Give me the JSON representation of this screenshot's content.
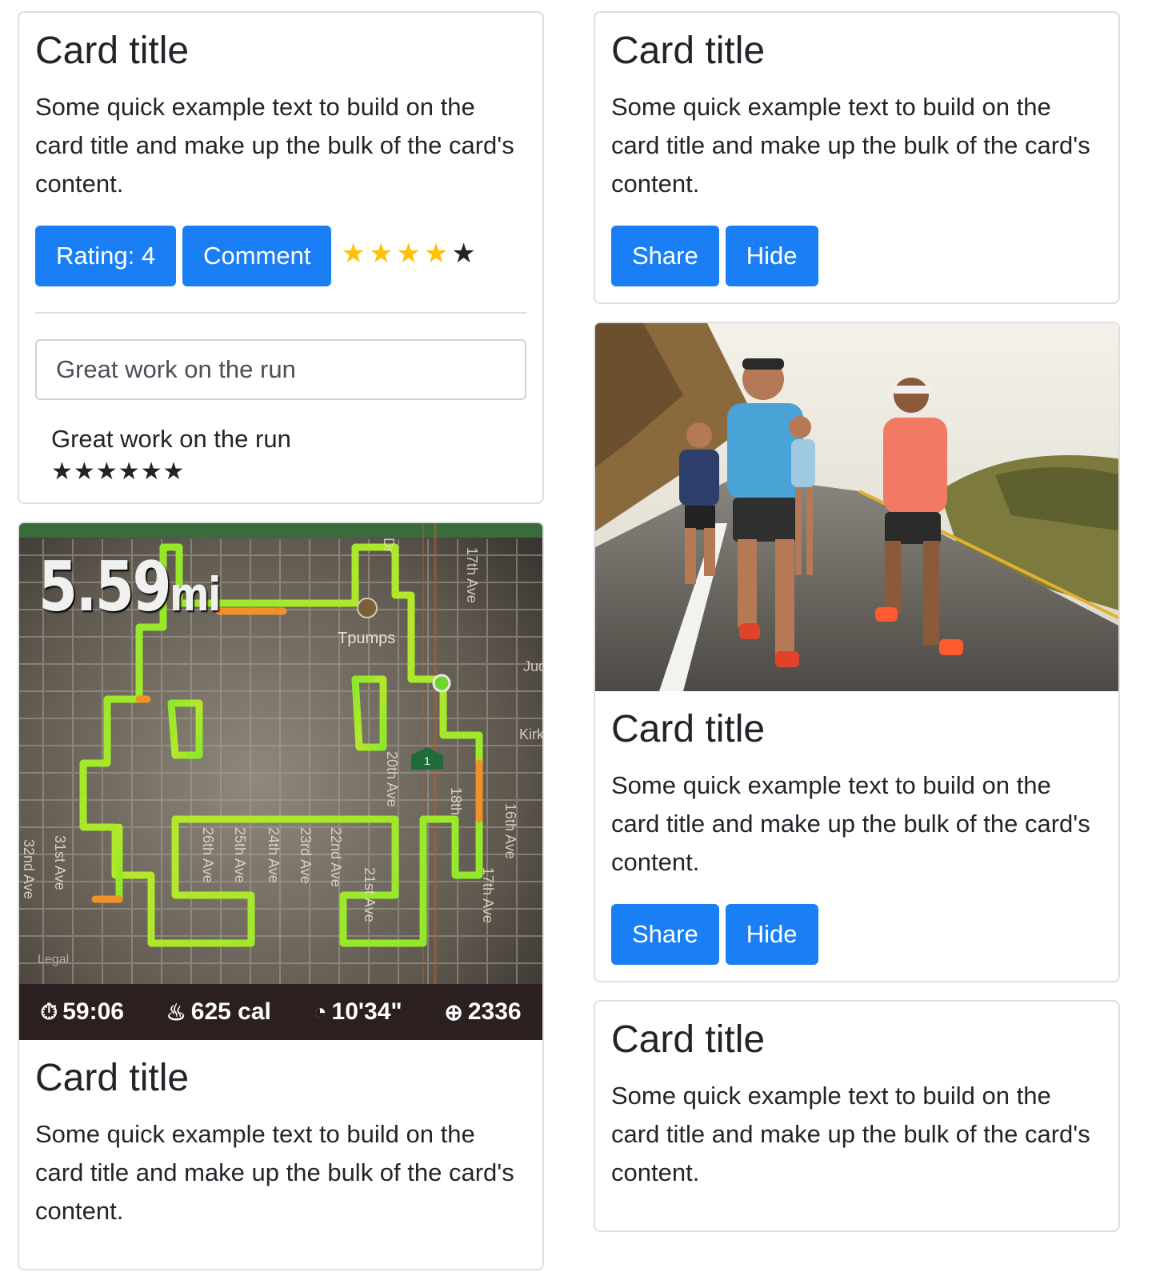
{
  "cards": {
    "rating_card": {
      "title": "Card title",
      "text": "Some quick example text to build on the card title and make up the bulk of the card's content.",
      "rating_button": "Rating: 4",
      "comment_button": "Comment",
      "rating": {
        "value": 4,
        "max": 5
      },
      "comment_input": {
        "value": "Great work on the run",
        "placeholder": ""
      },
      "comment": {
        "text": "Great work on the run",
        "stars": 6
      }
    },
    "map_card": {
      "distance": "5.59",
      "distance_unit": "mi",
      "poi_label": "Tpumps",
      "legal": "Legal",
      "street_labels": [
        "17th Ave",
        "Jud",
        "Kirk",
        "20th Ave",
        "18th",
        "16th Ave",
        "32nd Ave",
        "31st Ave",
        "26th Ave",
        "25th Ave",
        "24th Ave",
        "23rd Ave",
        "22nd Ave",
        "21st Ave",
        "17th Ave",
        "Dr"
      ],
      "marker_label": "1",
      "stats": {
        "time": "59:06",
        "calories": "625 cal",
        "pace": "10'34\"",
        "fuel": "2336"
      },
      "title": "Card title",
      "text": "Some quick example text to build on the card title and make up the bulk of the card's content."
    },
    "share_card_1": {
      "title": "Card title",
      "text": "Some quick example text to build on the card title and make up the bulk of the card's content.",
      "share_button": "Share",
      "hide_button": "Hide"
    },
    "photo_card": {
      "title": "Card title",
      "text": "Some quick example text to build on the card title and make up the bulk of the card's content.",
      "share_button": "Share",
      "hide_button": "Hide"
    },
    "text_card": {
      "title": "Card title",
      "text": "Some quick example text to build on the card title and make up the bulk of the card's content."
    }
  },
  "colors": {
    "primary": "#1a7ff5",
    "star_filled": "#ffc107",
    "star_empty": "#212529",
    "route_green": "#8be82a",
    "route_orange": "#f0922a"
  },
  "icons": [
    "star-icon",
    "stopwatch-icon",
    "flame-icon",
    "pace-icon",
    "fuel-icon",
    "location-pin-icon"
  ]
}
